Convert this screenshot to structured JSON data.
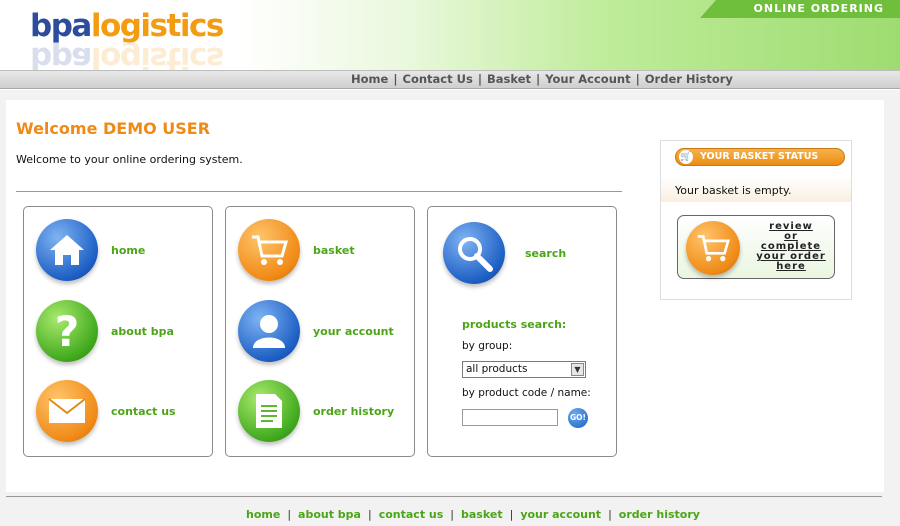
{
  "header": {
    "logo_part1": "bpa",
    "logo_part2": "logistics",
    "badge": "ONLINE ORDERING",
    "nav": [
      "Home",
      "Contact Us",
      "Basket",
      "Your Account",
      "Order History"
    ]
  },
  "main": {
    "welcome": "Welcome DEMO USER",
    "intro": "Welcome to your online ordering system."
  },
  "tiles": {
    "home": "home",
    "about": "about bpa",
    "contact": "contact us",
    "basket": "basket",
    "account": "your account",
    "history": "order history",
    "search": "search"
  },
  "products_search": {
    "title": "products search:",
    "by_group": "by group:",
    "group_selected": "all products",
    "by_code": "by product code / name:",
    "code_value": "",
    "go": "GO!"
  },
  "basket_status": {
    "title": "YOUR BASKET STATUS",
    "message": "Your basket is empty.",
    "review_lines": [
      "review",
      "or",
      "complete",
      "your order",
      "here"
    ]
  },
  "footer": {
    "nav": [
      "home",
      "about bpa",
      "contact us",
      "basket",
      "your account",
      "order history"
    ]
  },
  "colors": {
    "accent_green": "#4ba516",
    "accent_orange": "#f08a16",
    "brand_blue": "#2d4c9c"
  },
  "icons": [
    "home-icon",
    "question-icon",
    "mail-icon",
    "cart-icon",
    "user-icon",
    "document-icon",
    "magnifier-icon"
  ]
}
